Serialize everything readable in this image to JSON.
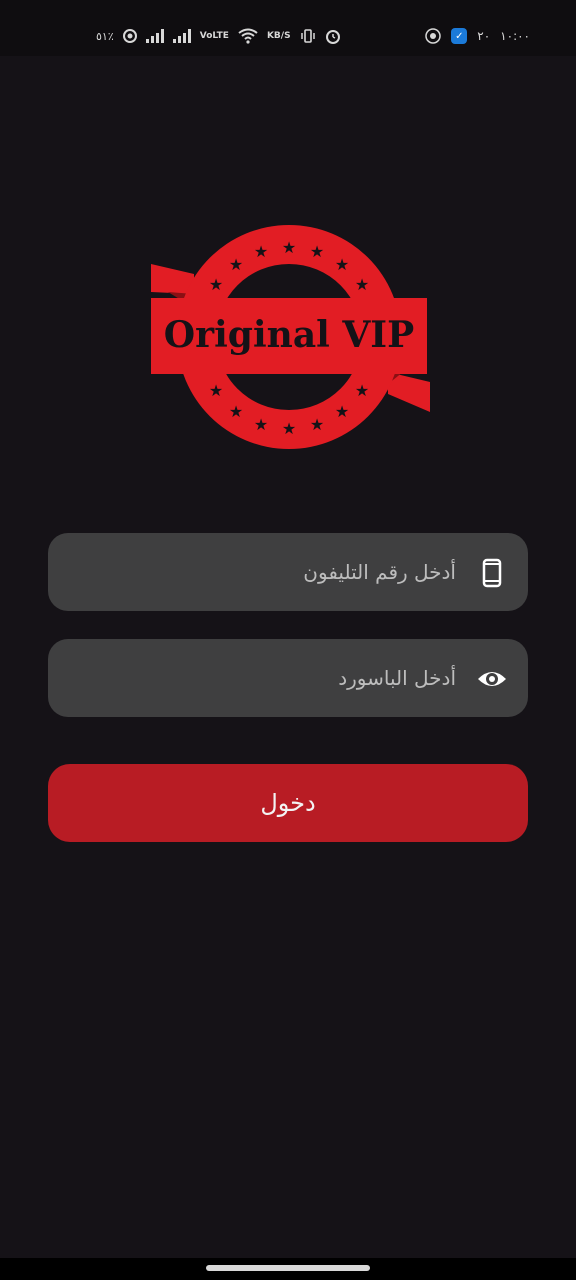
{
  "status_bar": {
    "battery": "٥١٪",
    "time": "١٠:٠٠",
    "network_type": "VoLTE",
    "speed": "KB/S",
    "notification": "٢٠"
  },
  "logo": {
    "text": "Original VIP"
  },
  "form": {
    "phone_placeholder": "أدخل رقم التليفون",
    "password_placeholder": "أدخل الباسورد",
    "login_label": "دخول"
  },
  "colors": {
    "background": "#151217",
    "field": "#3f3f40",
    "button": "#b81c24",
    "brand_red": "#e21d24"
  }
}
